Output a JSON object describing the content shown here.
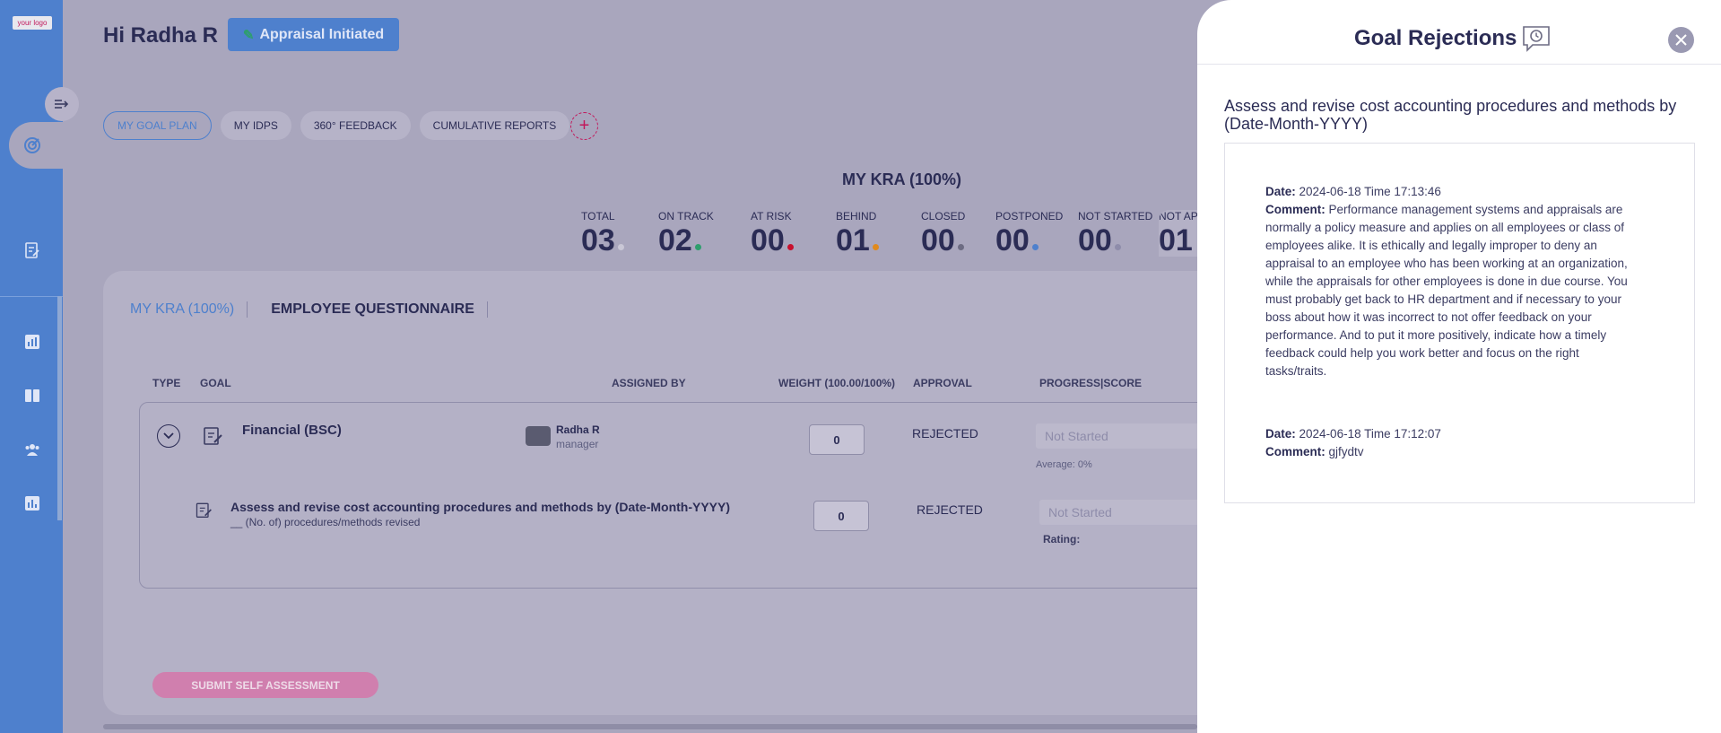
{
  "brand": {
    "logo_text": "your logo"
  },
  "header": {
    "greeting": "Hi Radha R",
    "status": "Appraisal Initiated"
  },
  "tabs": [
    {
      "label": "MY GOAL PLAN",
      "active": true
    },
    {
      "label": "MY IDPS"
    },
    {
      "label": "360° FEEDBACK"
    },
    {
      "label": "CUMULATIVE REPORTS"
    }
  ],
  "kra_summary": {
    "title": "MY KRA (100%)",
    "stats": [
      {
        "label": "TOTAL",
        "value": "03",
        "color": "#c9c7d6"
      },
      {
        "label": "ON TRACK",
        "value": "02",
        "color": "#2e9e6d"
      },
      {
        "label": "AT RISK",
        "value": "00",
        "color": "#c8102e"
      },
      {
        "label": "BEHIND",
        "value": "01",
        "color": "#e08a1e"
      },
      {
        "label": "CLOSED",
        "value": "00",
        "color": "#6d6c83"
      },
      {
        "label": "POSTPONED",
        "value": "00",
        "color": "#4e80cd"
      },
      {
        "label": "NOT STARTED",
        "value": "00",
        "color": "#8e8caa"
      },
      {
        "label": "NOT APPROVED",
        "value": "01",
        "color": "#8e8caa"
      }
    ]
  },
  "sub_tabs": [
    {
      "label": "MY KRA (100%)",
      "active": true
    },
    {
      "label": "EMPLOYEE QUESTIONNAIRE"
    }
  ],
  "table": {
    "columns": [
      "TYPE",
      "GOAL",
      "ASSIGNED BY",
      "WEIGHT (100.00/100%)",
      "APPROVAL",
      "PROGRESS|SCORE"
    ],
    "group": {
      "name": "Financial (BSC)",
      "assigned_by": "Radha R",
      "assigned_role": "manager",
      "weight": "0",
      "approval": "REJECTED",
      "progress": "Not Started",
      "average": "Average: 0%"
    },
    "goal": {
      "title": "Assess and revise cost accounting procedures and methods by (Date-Month-YYYY)",
      "measure": "__ (No. of) procedures/methods revised",
      "weight": "0",
      "approval": "REJECTED",
      "progress": "Not Started",
      "rating_label": "Rating:"
    }
  },
  "submit_label": "SUBMIT SELF ASSESSMENT",
  "drawer": {
    "title": "Goal Rejections",
    "goal_title": "Assess and revise cost accounting procedures and methods by (Date-Month-YYYY)",
    "date_label": "Date:",
    "comment_label": "Comment:",
    "comments": [
      {
        "date": "2024-06-18 Time 17:13:46",
        "text": "Performance management systems and appraisals are normally a policy measure and applies on all employees or class of employees alike. It is ethically and legally improper to deny an appraisal to an employee who has been working at an organization, while the appraisals for other employees is done in due course. You must probably get back to HR department and if necessary to your boss about how it was incorrect to not offer feedback on your performance. And to put it more positively, indicate how a timely feedback could help you work better and focus on the right tasks/traits."
      },
      {
        "date": "2024-06-18 Time 17:12:07",
        "text": "gjfydtv"
      }
    ]
  },
  "icons": {
    "collapse": "sidebar-collapse-icon",
    "goal": "target-icon",
    "review": "clipboard-edit-icon",
    "reports": "bar-chart-icon",
    "book": "book-icon",
    "team": "users-icon",
    "analytics": "analytics-icon",
    "close": "close-icon",
    "history": "chat-clock-icon"
  }
}
